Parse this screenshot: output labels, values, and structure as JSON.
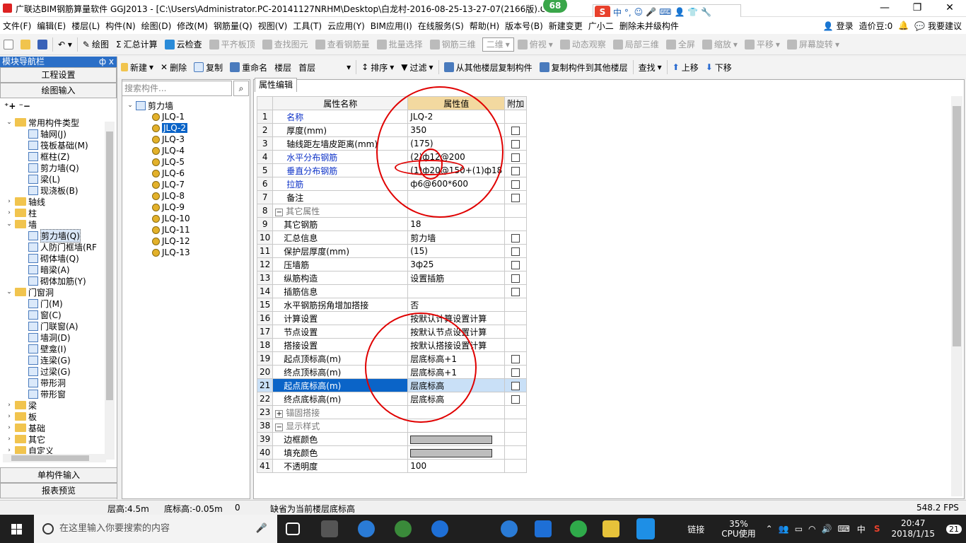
{
  "window": {
    "title": "广联达BIM钢筋算量软件 GGJ2013 - [C:\\Users\\Administrator.PC-20141127NRHM\\Desktop\\白龙村-2016-08-25-13-27-07(2166版).GG",
    "badge": "68"
  },
  "ime": {
    "label": "中 °,"
  },
  "menu": [
    "文件(F)",
    "编辑(E)",
    "楼层(L)",
    "构件(N)",
    "绘图(D)",
    "修改(M)",
    "钢筋量(Q)",
    "视图(V)",
    "工具(T)",
    "云应用(Y)",
    "BIM应用(I)",
    "在线服务(S)",
    "帮助(H)",
    "版本号(B)",
    "新建变更",
    "广小二",
    "删除未并级构件"
  ],
  "menu_right": {
    "login": "登录",
    "price": "造价豆:0",
    "suggest": "我要建议"
  },
  "toolbar1": [
    "绘图",
    "汇总计算",
    "云检查",
    "平齐板顶",
    "查找图元",
    "查看钢筋量",
    "批量选择",
    "钢筋三维",
    "二维",
    "俯视",
    "动态观察",
    "局部三维",
    "全屏",
    "缩放",
    "平移",
    "屏幕旋转"
  ],
  "toolbar2": {
    "new": "新建",
    "delete": "删除",
    "copy": "复制",
    "rename": "重命名",
    "floor_label": "楼层",
    "floor": "首层",
    "sort": "排序",
    "filter": "过滤",
    "copy_from": "从其他楼层复制构件",
    "copy_to": "复制构件到其他楼层",
    "find": "查找",
    "up": "上移",
    "down": "下移"
  },
  "nav": {
    "title": "模块导航栏",
    "pin": "ф x",
    "project": "工程设置",
    "draw": "绘图输入",
    "single": "单构件输入",
    "report": "报表预览"
  },
  "tree": [
    {
      "label": "常用构件类型",
      "type": "folder",
      "level": 0,
      "exp": "⌄"
    },
    {
      "label": "轴网(J)",
      "type": "comp",
      "level": 1
    },
    {
      "label": "筏板基础(M)",
      "type": "comp",
      "level": 1
    },
    {
      "label": "框柱(Z)",
      "type": "comp",
      "level": 1
    },
    {
      "label": "剪力墙(Q)",
      "type": "comp",
      "level": 1
    },
    {
      "label": "梁(L)",
      "type": "comp",
      "level": 1
    },
    {
      "label": "现浇板(B)",
      "type": "comp",
      "level": 1
    },
    {
      "label": "轴线",
      "type": "folder",
      "level": 0,
      "exp": "›"
    },
    {
      "label": "柱",
      "type": "folder",
      "level": 0,
      "exp": "›"
    },
    {
      "label": "墙",
      "type": "folder",
      "level": 0,
      "exp": "⌄"
    },
    {
      "label": "剪力墙(Q)",
      "type": "comp",
      "level": 1
    },
    {
      "label": "人防门框墙(RF",
      "type": "comp",
      "level": 1
    },
    {
      "label": "砌体墙(Q)",
      "type": "comp",
      "level": 1
    },
    {
      "label": "暗梁(A)",
      "type": "comp",
      "level": 1
    },
    {
      "label": "砌体加筋(Y)",
      "type": "comp",
      "level": 1
    },
    {
      "label": "门窗洞",
      "type": "folder",
      "level": 0,
      "exp": "⌄"
    },
    {
      "label": "门(M)",
      "type": "comp",
      "level": 1
    },
    {
      "label": "窗(C)",
      "type": "comp",
      "level": 1
    },
    {
      "label": "门联窗(A)",
      "type": "comp",
      "level": 1
    },
    {
      "label": "墙洞(D)",
      "type": "comp",
      "level": 1
    },
    {
      "label": "壁龛(I)",
      "type": "comp",
      "level": 1
    },
    {
      "label": "连梁(G)",
      "type": "comp",
      "level": 1
    },
    {
      "label": "过梁(G)",
      "type": "comp",
      "level": 1
    },
    {
      "label": "带形洞",
      "type": "comp",
      "level": 1
    },
    {
      "label": "带形窗",
      "type": "comp",
      "level": 1
    },
    {
      "label": "梁",
      "type": "folder",
      "level": 0,
      "exp": "›"
    },
    {
      "label": "板",
      "type": "folder",
      "level": 0,
      "exp": "›"
    },
    {
      "label": "基础",
      "type": "folder",
      "level": 0,
      "exp": "›"
    },
    {
      "label": "其它",
      "type": "folder",
      "level": 0,
      "exp": "›"
    },
    {
      "label": "自定义",
      "type": "folder",
      "level": 0,
      "exp": "›"
    }
  ],
  "components": {
    "search_placeholder": "搜索构件...",
    "root": "剪力墙",
    "items": [
      "JLQ-1",
      "JLQ-2",
      "JLQ-3",
      "JLQ-4",
      "JLQ-5",
      "JLQ-6",
      "JLQ-7",
      "JLQ-8",
      "JLQ-9",
      "JLQ-10",
      "JLQ-11",
      "JLQ-12",
      "JLQ-13"
    ],
    "selected": "JLQ-2"
  },
  "props": {
    "tab": "属性编辑",
    "headers": [
      "属性名称",
      "属性值",
      "附加"
    ],
    "rows": [
      {
        "n": "1",
        "name": "名称",
        "val": "JLQ-2",
        "chk": false,
        "blue": true
      },
      {
        "n": "2",
        "name": "厚度(mm)",
        "val": "350",
        "chk": true
      },
      {
        "n": "3",
        "name": "轴线距左墙皮距离(mm)",
        "val": "(175)",
        "chk": true
      },
      {
        "n": "4",
        "name": "水平分布钢筋",
        "val": "(2)ф12@200",
        "chk": true,
        "blue": true
      },
      {
        "n": "5",
        "name": "垂直分布钢筋",
        "val": "(1)ф20@150+(1)ф18",
        "chk": true,
        "blue": true
      },
      {
        "n": "6",
        "name": "拉筋",
        "val": "ф6@600*600",
        "chk": true,
        "blue": true
      },
      {
        "n": "7",
        "name": "备注",
        "val": "",
        "chk": true
      },
      {
        "n": "8",
        "name": "其它属性",
        "val": "",
        "group": "−"
      },
      {
        "n": "9",
        "name": "其它钢筋",
        "val": "18",
        "indent": true
      },
      {
        "n": "10",
        "name": "汇总信息",
        "val": "剪力墙",
        "chk": true,
        "indent": true
      },
      {
        "n": "11",
        "name": "保护层厚度(mm)",
        "val": "(15)",
        "chk": true,
        "indent": true
      },
      {
        "n": "12",
        "name": "压墙筋",
        "val": "3ф25",
        "chk": true,
        "indent": true
      },
      {
        "n": "13",
        "name": "纵筋构造",
        "val": "设置插筋",
        "chk": true,
        "indent": true
      },
      {
        "n": "14",
        "name": "插筋信息",
        "val": "",
        "chk": true,
        "indent": true
      },
      {
        "n": "15",
        "name": "水平钢筋拐角增加搭接",
        "val": "否",
        "indent": true
      },
      {
        "n": "16",
        "name": "计算设置",
        "val": "按默认计算设置计算",
        "indent": true
      },
      {
        "n": "17",
        "name": "节点设置",
        "val": "按默认节点设置计算",
        "indent": true
      },
      {
        "n": "18",
        "name": "搭接设置",
        "val": "按默认搭接设置计算",
        "indent": true
      },
      {
        "n": "19",
        "name": "起点顶标高(m)",
        "val": "层底标高+1",
        "chk": true,
        "indent": true
      },
      {
        "n": "20",
        "name": "终点顶标高(m)",
        "val": "层底标高+1",
        "chk": true,
        "indent": true
      },
      {
        "n": "21",
        "name": "起点底标高(m)",
        "val": "层底标高",
        "chk": true,
        "indent": true,
        "sel": true
      },
      {
        "n": "22",
        "name": "终点底标高(m)",
        "val": "层底标高",
        "chk": true,
        "indent": true
      },
      {
        "n": "23",
        "name": "锚固搭接",
        "val": "",
        "group": "+"
      },
      {
        "n": "38",
        "name": "显示样式",
        "val": "",
        "group": "−"
      },
      {
        "n": "39",
        "name": "边框颜色",
        "val": "",
        "color": true,
        "indent": true
      },
      {
        "n": "40",
        "name": "填充颜色",
        "val": "",
        "color": true,
        "indent": true
      },
      {
        "n": "41",
        "name": "不透明度",
        "val": "100",
        "indent": true
      }
    ]
  },
  "status": {
    "floor_h": "层高:4.5m",
    "bottom": "底标高:-0.05m",
    "zero": "0",
    "hint": "缺省为当前楼层底标高",
    "fps": "548.2 FPS"
  },
  "taskbar": {
    "search": "在这里输入你要搜索的内容",
    "link": "链接",
    "cpu_pct": "35%",
    "cpu_label": "CPU使用",
    "lang": "中",
    "time": "20:47",
    "date": "2018/1/15",
    "notif": "21"
  },
  "colors": {
    "accent": "#2b6fc7",
    "selected_row": "#0a64c8",
    "annotation": "#e00000",
    "header_value": "#f3d9a0"
  }
}
